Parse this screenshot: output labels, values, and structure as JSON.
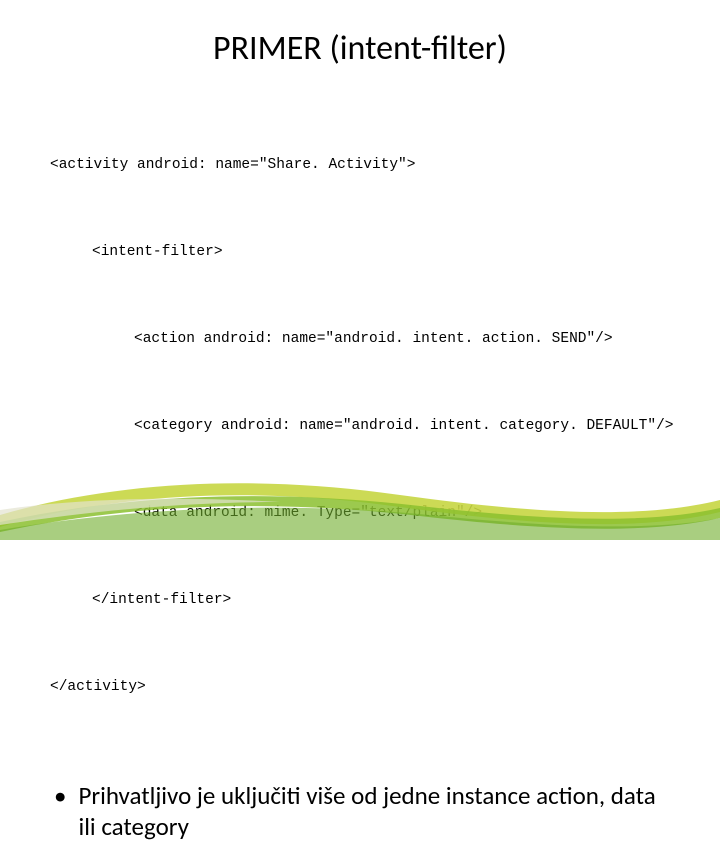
{
  "title": "PRIMER (intent-filter)",
  "code": {
    "l0": "<activity android: name=\"Share. Activity\">",
    "l1": "<intent-filter>",
    "l2": "<action android: name=\"android. intent. action. SEND\"/>",
    "l3": "<category android: name=\"android. intent. category. DEFAULT\"/>",
    "l4": "<data android: mime. Type=\"text/plain\"/>",
    "l5": "</intent-filter>",
    "l6": "</activity>"
  },
  "bullet": "Prihvatljivo je uključiti više od jedne instance action, data ili category"
}
